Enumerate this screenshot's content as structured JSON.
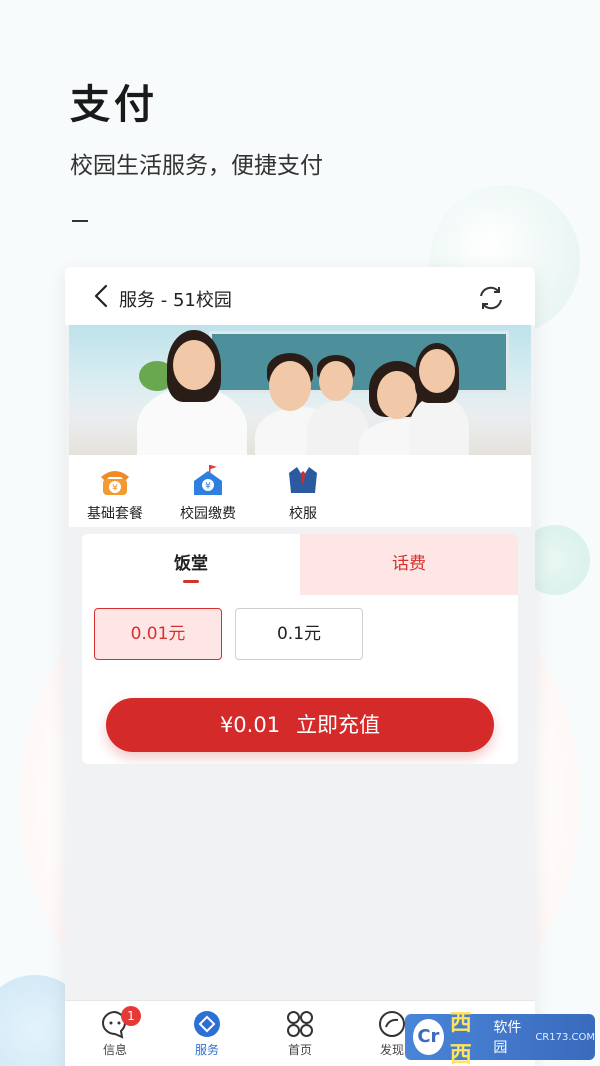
{
  "hero": {
    "title": "支付",
    "subtitle": "校园生活服务，便捷支付",
    "dash": "–"
  },
  "nav": {
    "title": "服务 - 51校园",
    "back_icon": "chevron-left-icon",
    "refresh_icon": "refresh-icon"
  },
  "shortcuts": [
    {
      "label": "基础套餐",
      "icon": "phone-yuan-icon",
      "color": "#f08a24"
    },
    {
      "label": "校园缴费",
      "icon": "school-yuan-icon",
      "color": "#2f7fe0"
    },
    {
      "label": "校服",
      "icon": "uniform-icon",
      "color": "#2c5aa0"
    }
  ],
  "tabs": {
    "canteen": "饭堂",
    "phone_fee": "话费",
    "active": "canteen"
  },
  "amounts": [
    {
      "label": "0.01元",
      "selected": true
    },
    {
      "label": "0.1元",
      "selected": false
    }
  ],
  "pay": {
    "amount": "¥0.01",
    "label": "立即充值"
  },
  "tabbar": [
    {
      "label": "信息",
      "icon": "chat-bubble-icon",
      "badge": "1"
    },
    {
      "label": "服务",
      "icon": "service-icon",
      "active": true
    },
    {
      "label": "首页",
      "icon": "grid-icon"
    },
    {
      "label": "发现",
      "icon": "discover-icon"
    }
  ],
  "watermark": {
    "logo": "Cr",
    "name": "西西",
    "site": "软件园",
    "url": "CR173.COM"
  },
  "colors": {
    "accent_red": "#d52a2a",
    "tab_bg": "#fde6e5",
    "active_blue": "#2c6fd6"
  }
}
